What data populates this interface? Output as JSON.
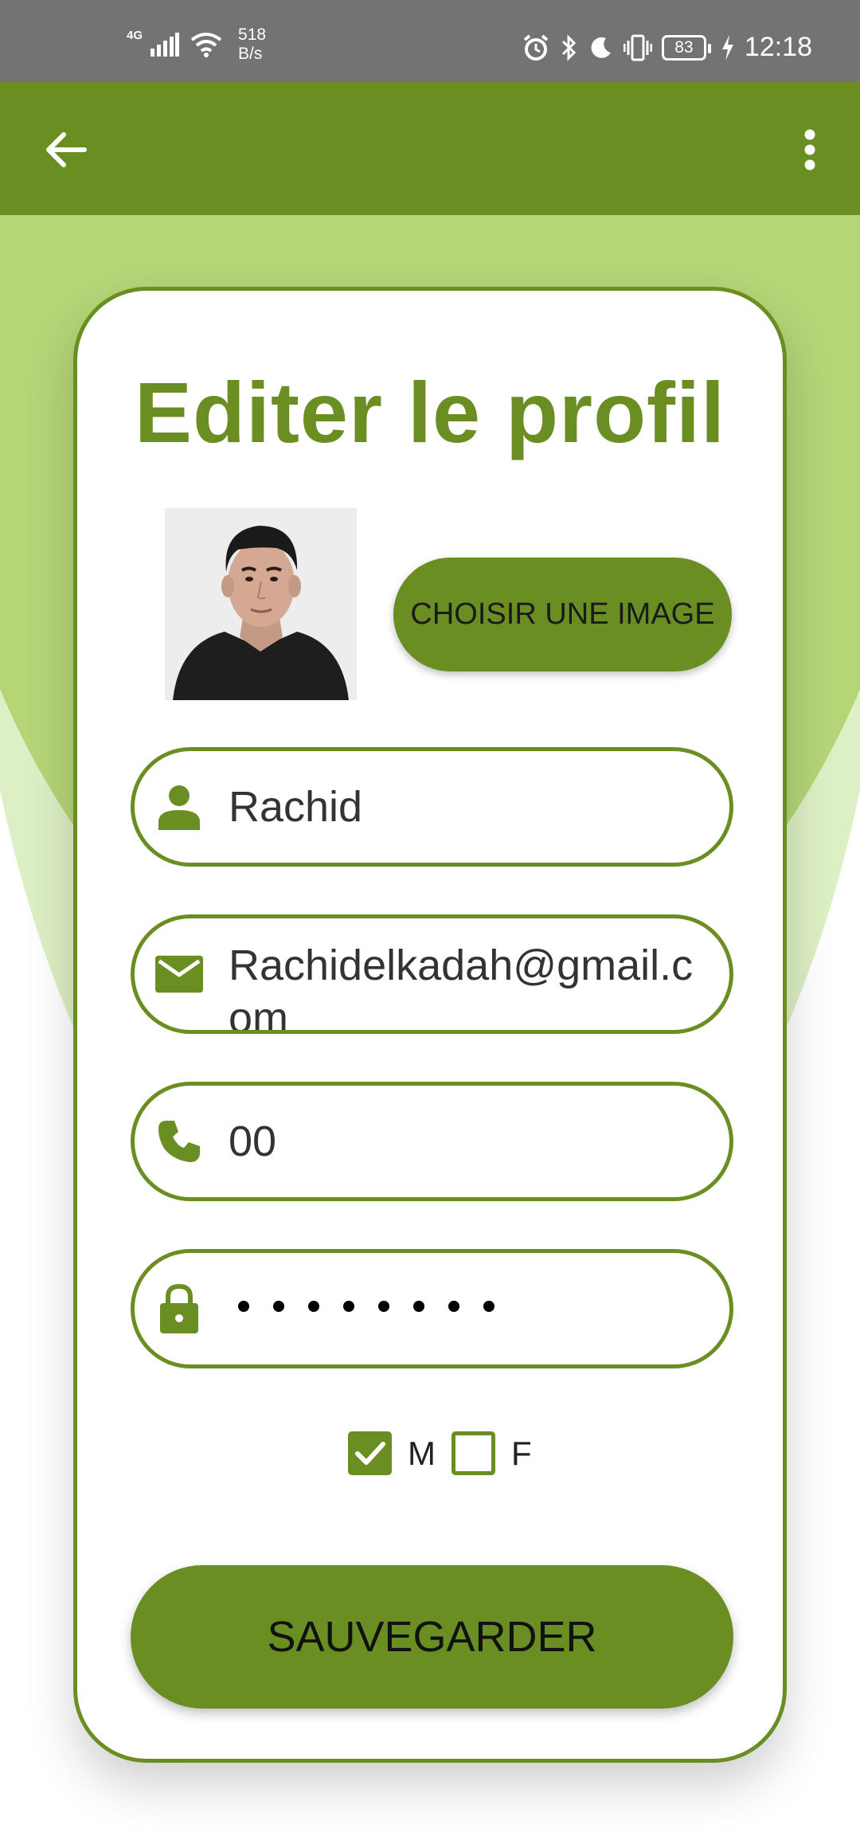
{
  "status_bar": {
    "network": "4G",
    "speed_value": "518",
    "speed_unit": "B/s",
    "battery": "83",
    "time": "12:18"
  },
  "app_bar": {
    "back_icon": "arrow-left-icon",
    "menu_icon": "more-vert-icon"
  },
  "profile": {
    "title": "Editer le profil",
    "choose_image_label": "CHOISIR UNE IMAGE",
    "fields": {
      "name": "Rachid",
      "email": "Rachidelkadah@gmail.com",
      "phone": "00"
    },
    "gender": {
      "male_label": "M",
      "female_label": "F",
      "male_checked": true,
      "female_checked": false
    },
    "save_label": "SAUVEGARDER"
  },
  "colors": {
    "primary": "#6b8e23",
    "light_green": "#b5d577",
    "pale_green": "#ddefc4",
    "status_bar": "#737373"
  }
}
